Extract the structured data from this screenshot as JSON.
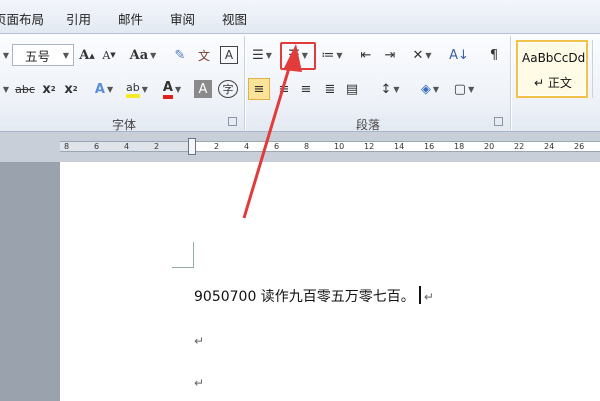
{
  "tabs": [
    "页面布局",
    "引用",
    "邮件",
    "审阅",
    "视图"
  ],
  "ribbon": {
    "font_size_value": "五号",
    "font_group_label": "字体",
    "paragraph_group_label": "段落",
    "style_tile": {
      "preview": "AaBbCcDd",
      "name": "↵ 正文"
    }
  },
  "ruler": {
    "numbers": [
      "8",
      "6",
      "4",
      "2",
      "",
      "2",
      "4",
      "6",
      "8",
      "10",
      "12",
      "14",
      "16",
      "18",
      "20",
      "22",
      "24",
      "26"
    ]
  },
  "document": {
    "line_text": "9050700 读作九百零五万零七百。",
    "para_mark": "↵"
  },
  "annotation": {
    "color": "#e23b3b"
  }
}
